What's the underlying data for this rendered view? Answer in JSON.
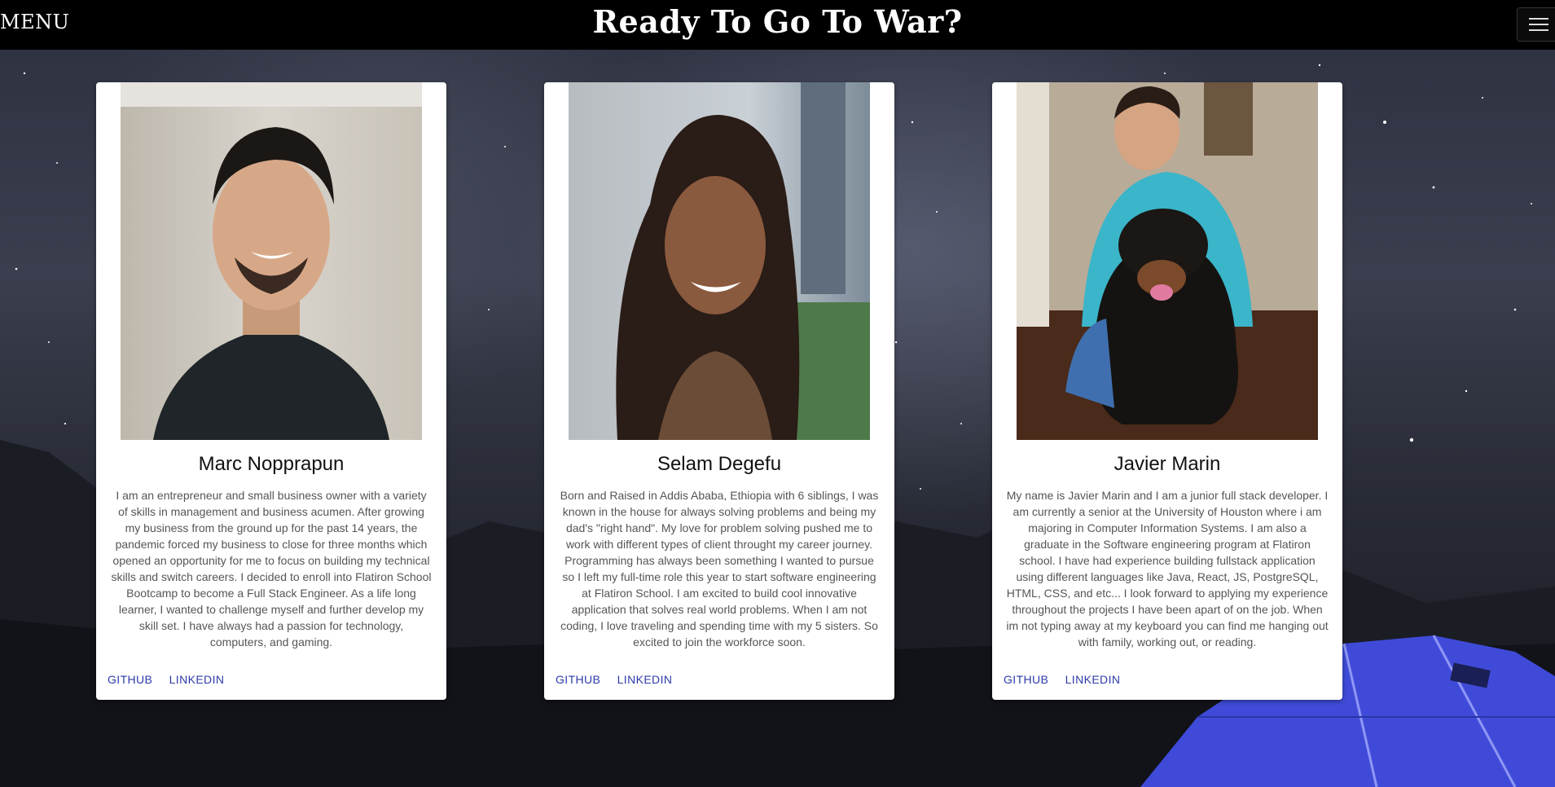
{
  "header": {
    "menu_label": "MENU",
    "title": "Ready To Go To War?"
  },
  "team": [
    {
      "name": "Marc Nopprapun",
      "bio": "I am an entrepreneur and small business owner with a variety of skills in management and business acumen. After growing my business from the ground up for the past 14 years, the pandemic forced my business to close for three months which opened an opportunity for me to focus on building my technical skills and switch careers. I decided to enroll into Flatiron School Bootcamp to become a Full Stack Engineer. As a life long learner, I wanted to challenge myself and further develop my skill set. I have always had a passion for technology, computers, and gaming.",
      "github_label": "GITHUB",
      "linkedin_label": "LINKEDIN"
    },
    {
      "name": "Selam Degefu",
      "bio": "Born and Raised in Addis Ababa, Ethiopia with 6 siblings, I was known in the house for always solving problems and being my dad's \"right hand\". My love for problem solving pushed me to work with different types of client throught my career journey. Programming has always been something I wanted to pursue so I left my full-time role this year to start software engineering at Flatiron School. I am excited to build cool innovative application that solves real world problems. When I am not coding, I love traveling and spending time with my 5 sisters. So excited to join the workforce soon.",
      "github_label": "GITHUB",
      "linkedin_label": "LINKEDIN"
    },
    {
      "name": "Javier Marin",
      "bio": "My name is Javier Marin and I am a junior full stack developer. I am currently a senior at the University of Houston where i am majoring in Computer Information Systems. I am also a graduate in the Software engineering program at Flatiron school. I have had experience building fullstack application using different languages like Java, React, JS, PostgreSQL, HTML, CSS, and etc... I look forward to applying my experience throughout the projects I have been apart of on the job. When im not typing away at my keyboard you can find me hanging out with family, working out, or reading.",
      "github_label": "GITHUB",
      "linkedin_label": "LINKEDIN"
    }
  ],
  "colors": {
    "topbar": "#000000",
    "link": "#2d3aa8",
    "tent": "#3f4bd8"
  }
}
